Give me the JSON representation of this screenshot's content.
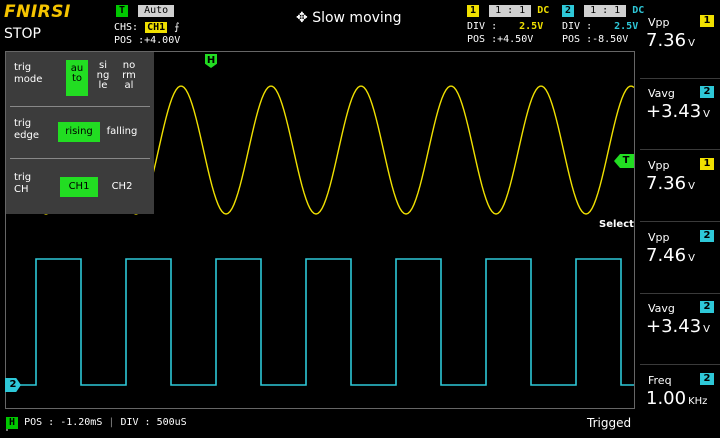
{
  "brand": "FNIRSI",
  "run_state": "STOP",
  "trigger": {
    "badge": "T",
    "mode": "Auto",
    "chs_label": "CHS:",
    "chs_value": "CH1",
    "edge_symbol": "⨍",
    "pos_label": "POS :",
    "pos_value": "+4.00V"
  },
  "center_title": "Slow moving",
  "ch1": {
    "badge": "1",
    "probe": "1 : 1",
    "coupling": "DC",
    "div_label": "DIV :",
    "div_value": "2.5V",
    "pos_label": "POS :",
    "pos_value": "+4.50V"
  },
  "ch2": {
    "badge": "2",
    "probe": "1 : 1",
    "coupling": "DC",
    "div_label": "DIV :",
    "div_value": "2.5V",
    "pos_label": "POS :",
    "pos_value": "-8.50V"
  },
  "trig_menu": {
    "mode_label": "trig\nmode",
    "mode_options": [
      "au\nto",
      "si\nng\nle",
      "no\nrm\nal"
    ],
    "mode_selected": 0,
    "edge_label": "trig\nedge",
    "edge_options": [
      "rising",
      "falling"
    ],
    "edge_selected": 0,
    "ch_label": "trig\nCH",
    "ch_options": [
      "CH1",
      "CH2"
    ],
    "ch_selected": 0
  },
  "select_label": "Select",
  "markers": {
    "h": "H",
    "t": "T",
    "ch2": "2"
  },
  "measurements": [
    {
      "name": "Vpp",
      "channel": "1",
      "value": "7.36",
      "unit": "V"
    },
    {
      "name": "Vavg",
      "channel": "2",
      "value": "+3.43",
      "unit": "V"
    },
    {
      "name": "Vpp",
      "channel": "1",
      "value": "7.36",
      "unit": "V"
    },
    {
      "name": "Vpp",
      "channel": "2",
      "value": "7.46",
      "unit": "V"
    },
    {
      "name": "Vavg",
      "channel": "2",
      "value": "+3.43",
      "unit": "V"
    },
    {
      "name": "Freq",
      "channel": "2",
      "value": "1.00",
      "unit": "KHz"
    }
  ],
  "timebase": {
    "badge": "H",
    "pos_label": "POS :",
    "pos_value": "-1.20mS",
    "div_label": "DIV :",
    "div_value": "500uS"
  },
  "trigger_status": "Trigged",
  "colors": {
    "ch1": "#f0e000",
    "ch2": "#2ec8d8",
    "accent": "#22dd22"
  }
}
